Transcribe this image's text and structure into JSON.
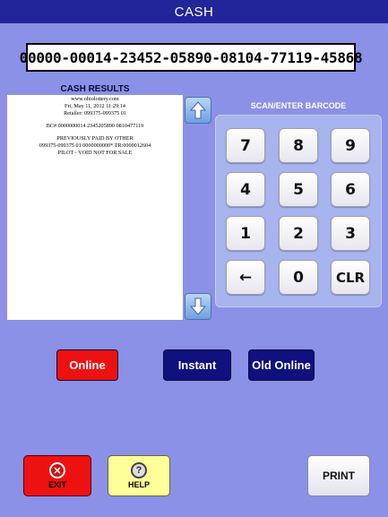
{
  "window": {
    "title": "CASH"
  },
  "barcode": {
    "value": "00000-00014-23452-05890-08104-77119-45868"
  },
  "results": {
    "title": "CASH RESULTS",
    "lines": [
      "www.ohiolottery.com",
      "Fri, May 11, 2012  11:29:14",
      "Retailer:  099375-099375 01",
      "",
      "BC# 0000000014 2345205890 0810477119",
      "",
      "PREVIOUSLY PAID BY OTHER",
      "099375-099375 01 0000000000* TR:0000012604",
      "PILOT - VOID NOT FOR SALE"
    ]
  },
  "keypad": {
    "title": "SCAN/ENTER BARCODE",
    "keys": [
      "7",
      "8",
      "9",
      "4",
      "5",
      "6",
      "1",
      "2",
      "3",
      "←",
      "0",
      "CLR"
    ]
  },
  "modes": {
    "online": "Online",
    "instant": "Instant",
    "old_online": "Old Online"
  },
  "buttons": {
    "exit": "EXIT",
    "help": "HELP",
    "print": "PRINT"
  },
  "icons": {
    "up": "arrow-up-icon",
    "down": "arrow-down-icon",
    "exit": "close-circle-icon",
    "help": "question-circle-icon"
  }
}
